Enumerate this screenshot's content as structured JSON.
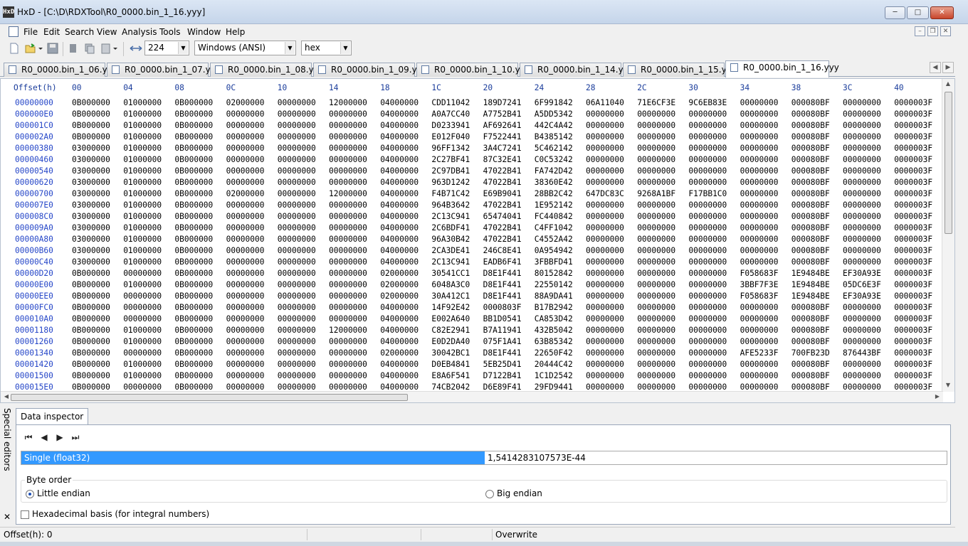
{
  "window": {
    "app_icon": "HxD",
    "title": "HxD - [C:\\D\\RDXTool\\R0_0000.bin_1_16.yyy]",
    "min_icon": "─",
    "max_icon": "□",
    "close_icon": "✕"
  },
  "menu": {
    "items": [
      "File",
      "Edit",
      "Search",
      "View",
      "Analysis",
      "Tools",
      "Window",
      "Help"
    ],
    "mdi_min": "–",
    "mdi_restore": "❐",
    "mdi_close": "✕"
  },
  "toolbar": {
    "bytes_per_row": "224",
    "charset": "Windows (ANSI)",
    "offset_base": "hex"
  },
  "tabs": [
    {
      "label": "R0_0000.bin_1_06.yyy"
    },
    {
      "label": "R0_0000.bin_1_07.yyy"
    },
    {
      "label": "R0_0000.bin_1_08.yyy"
    },
    {
      "label": "R0_0000.bin_1_09.yyy"
    },
    {
      "label": "R0_0000.bin_1_10.yyy"
    },
    {
      "label": "R0_0000.bin_1_14.yyy"
    },
    {
      "label": "R0_0000.bin_1_15.yyy"
    },
    {
      "label": "R0_0000.bin_1_16.yyy",
      "active": true
    }
  ],
  "hex": {
    "offset_header": "Offset(h)",
    "columns": [
      "00",
      "04",
      "08",
      "0C",
      "10",
      "14",
      "18",
      "1C",
      "20",
      "24",
      "28",
      "2C",
      "30",
      "34",
      "38",
      "3C",
      "40"
    ],
    "rows": [
      {
        "offset": "00000000",
        "cells": [
          "0B000000",
          "01000000",
          "0B000000",
          "02000000",
          "00000000",
          "12000000",
          "04000000",
          "CDD11042",
          "189D7241",
          "6F991842",
          "06A11040",
          "71E6CF3E",
          "9C6EB83E",
          "00000000",
          "000080BF",
          "00000000",
          "0000003F"
        ]
      },
      {
        "offset": "000000E0",
        "cells": [
          "0B000000",
          "01000000",
          "0B000000",
          "00000000",
          "00000000",
          "00000000",
          "04000000",
          "A0A7CC40",
          "A7752B41",
          "A5DD5342",
          "00000000",
          "00000000",
          "00000000",
          "00000000",
          "000080BF",
          "00000000",
          "0000003F"
        ]
      },
      {
        "offset": "000001C0",
        "cells": [
          "0B000000",
          "01000000",
          "0B000000",
          "00000000",
          "00000000",
          "00000000",
          "04000000",
          "D0233941",
          "AF692641",
          "442C4A42",
          "00000000",
          "00000000",
          "00000000",
          "00000000",
          "000080BF",
          "00000000",
          "0000003F"
        ]
      },
      {
        "offset": "000002A0",
        "cells": [
          "0B000000",
          "01000000",
          "0B000000",
          "00000000",
          "00000000",
          "00000000",
          "04000000",
          "E012F040",
          "F7522441",
          "B4385142",
          "00000000",
          "00000000",
          "00000000",
          "00000000",
          "000080BF",
          "00000000",
          "0000003F"
        ]
      },
      {
        "offset": "00000380",
        "cells": [
          "03000000",
          "01000000",
          "0B000000",
          "00000000",
          "00000000",
          "00000000",
          "04000000",
          "96FF1342",
          "3A4C7241",
          "5C462142",
          "00000000",
          "00000000",
          "00000000",
          "00000000",
          "000080BF",
          "00000000",
          "0000003F"
        ]
      },
      {
        "offset": "00000460",
        "cells": [
          "03000000",
          "01000000",
          "0B000000",
          "00000000",
          "00000000",
          "00000000",
          "04000000",
          "2C27BF41",
          "87C32E41",
          "C0C53242",
          "00000000",
          "00000000",
          "00000000",
          "00000000",
          "000080BF",
          "00000000",
          "0000003F"
        ]
      },
      {
        "offset": "00000540",
        "cells": [
          "03000000",
          "01000000",
          "0B000000",
          "00000000",
          "00000000",
          "00000000",
          "04000000",
          "2C97DB41",
          "47022B41",
          "FA742D42",
          "00000000",
          "00000000",
          "00000000",
          "00000000",
          "000080BF",
          "00000000",
          "0000003F"
        ]
      },
      {
        "offset": "00000620",
        "cells": [
          "03000000",
          "01000000",
          "0B000000",
          "00000000",
          "00000000",
          "00000000",
          "04000000",
          "963D1242",
          "47022B41",
          "38360E42",
          "00000000",
          "00000000",
          "00000000",
          "00000000",
          "000080BF",
          "00000000",
          "0000003F"
        ]
      },
      {
        "offset": "00000700",
        "cells": [
          "03000000",
          "01000000",
          "0B000000",
          "02000000",
          "00000000",
          "12000000",
          "04000000",
          "F4B71C42",
          "E69B9041",
          "28BB2C42",
          "647DC83C",
          "9268A1BF",
          "F17BB1C0",
          "00000000",
          "000080BF",
          "00000000",
          "0000003F"
        ]
      },
      {
        "offset": "000007E0",
        "cells": [
          "03000000",
          "01000000",
          "0B000000",
          "00000000",
          "00000000",
          "00000000",
          "04000000",
          "964B3642",
          "47022B41",
          "1E952142",
          "00000000",
          "00000000",
          "00000000",
          "00000000",
          "000080BF",
          "00000000",
          "0000003F"
        ]
      },
      {
        "offset": "000008C0",
        "cells": [
          "03000000",
          "01000000",
          "0B000000",
          "00000000",
          "00000000",
          "00000000",
          "04000000",
          "2C13C941",
          "65474041",
          "FC440842",
          "00000000",
          "00000000",
          "00000000",
          "00000000",
          "000080BF",
          "00000000",
          "0000003F"
        ]
      },
      {
        "offset": "000009A0",
        "cells": [
          "03000000",
          "01000000",
          "0B000000",
          "00000000",
          "00000000",
          "00000000",
          "04000000",
          "2C6BDF41",
          "47022B41",
          "C4FF1042",
          "00000000",
          "00000000",
          "00000000",
          "00000000",
          "000080BF",
          "00000000",
          "0000003F"
        ]
      },
      {
        "offset": "00000A80",
        "cells": [
          "03000000",
          "01000000",
          "0B000000",
          "00000000",
          "00000000",
          "00000000",
          "04000000",
          "96A30B42",
          "47022B41",
          "C4552A42",
          "00000000",
          "00000000",
          "00000000",
          "00000000",
          "000080BF",
          "00000000",
          "0000003F"
        ]
      },
      {
        "offset": "00000B60",
        "cells": [
          "03000000",
          "01000000",
          "0B000000",
          "00000000",
          "00000000",
          "00000000",
          "04000000",
          "2CA3DE41",
          "246C8E41",
          "0A954942",
          "00000000",
          "00000000",
          "00000000",
          "00000000",
          "000080BF",
          "00000000",
          "0000003F"
        ]
      },
      {
        "offset": "00000C40",
        "cells": [
          "03000000",
          "01000000",
          "0B000000",
          "00000000",
          "00000000",
          "00000000",
          "04000000",
          "2C13C941",
          "EADB6F41",
          "3FBBFD41",
          "00000000",
          "00000000",
          "00000000",
          "00000000",
          "000080BF",
          "00000000",
          "0000003F"
        ]
      },
      {
        "offset": "00000D20",
        "cells": [
          "0B000000",
          "00000000",
          "0B000000",
          "00000000",
          "00000000",
          "00000000",
          "02000000",
          "30541CC1",
          "D8E1F441",
          "80152842",
          "00000000",
          "00000000",
          "00000000",
          "F058683F",
          "1E9484BE",
          "EF30A93E",
          "0000003F"
        ]
      },
      {
        "offset": "00000E00",
        "cells": [
          "0B000000",
          "01000000",
          "0B000000",
          "00000000",
          "00000000",
          "00000000",
          "02000000",
          "6048A3C0",
          "D8E1F441",
          "22550142",
          "00000000",
          "00000000",
          "00000000",
          "3BBF7F3E",
          "1E9484BE",
          "05DC6E3F",
          "0000003F"
        ]
      },
      {
        "offset": "00000EE0",
        "cells": [
          "0B000000",
          "00000000",
          "0B000000",
          "00000000",
          "00000000",
          "00000000",
          "02000000",
          "30A412C1",
          "D8E1F441",
          "88A9DA41",
          "00000000",
          "00000000",
          "00000000",
          "F058683F",
          "1E9484BE",
          "EF30A93E",
          "0000003F"
        ]
      },
      {
        "offset": "00000FC0",
        "cells": [
          "0B000000",
          "00000000",
          "0B000000",
          "00000000",
          "00000000",
          "00000000",
          "04000000",
          "14F92E42",
          "0000803F",
          "B17B2942",
          "00000000",
          "00000000",
          "00000000",
          "00000000",
          "000080BF",
          "00000000",
          "0000003F"
        ]
      },
      {
        "offset": "000010A0",
        "cells": [
          "0B000000",
          "00000000",
          "0B000000",
          "00000000",
          "00000000",
          "00000000",
          "04000000",
          "E002A640",
          "BB1D0541",
          "CA853D42",
          "00000000",
          "00000000",
          "00000000",
          "00000000",
          "000080BF",
          "00000000",
          "0000003F"
        ]
      },
      {
        "offset": "00001180",
        "cells": [
          "0B000000",
          "01000000",
          "0B000000",
          "00000000",
          "00000000",
          "12000000",
          "04000000",
          "C82E2941",
          "B7A11941",
          "432B5042",
          "00000000",
          "00000000",
          "00000000",
          "00000000",
          "000080BF",
          "00000000",
          "0000003F"
        ]
      },
      {
        "offset": "00001260",
        "cells": [
          "0B000000",
          "01000000",
          "0B000000",
          "00000000",
          "00000000",
          "00000000",
          "04000000",
          "E0D2DA40",
          "075F1A41",
          "63B85342",
          "00000000",
          "00000000",
          "00000000",
          "00000000",
          "000080BF",
          "00000000",
          "0000003F"
        ]
      },
      {
        "offset": "00001340",
        "cells": [
          "0B000000",
          "00000000",
          "0B000000",
          "00000000",
          "00000000",
          "00000000",
          "02000000",
          "30042BC1",
          "D8E1F441",
          "22650F42",
          "00000000",
          "00000000",
          "00000000",
          "AFE5233F",
          "700FB23D",
          "876443BF",
          "0000003F"
        ]
      },
      {
        "offset": "00001420",
        "cells": [
          "0B000000",
          "01000000",
          "0B000000",
          "00000000",
          "00000000",
          "00000000",
          "04000000",
          "D0EB4841",
          "5EB25D41",
          "20444C42",
          "00000000",
          "00000000",
          "00000000",
          "00000000",
          "000080BF",
          "00000000",
          "0000003F"
        ]
      },
      {
        "offset": "00001500",
        "cells": [
          "0B000000",
          "01000000",
          "0B000000",
          "00000000",
          "00000000",
          "00000000",
          "04000000",
          "E8A6F541",
          "D7122B41",
          "1C1D2542",
          "00000000",
          "00000000",
          "00000000",
          "00000000",
          "000080BF",
          "00000000",
          "0000003F"
        ]
      },
      {
        "offset": "000015E0",
        "cells": [
          "0B000000",
          "00000000",
          "0B000000",
          "00000000",
          "00000000",
          "00000000",
          "04000000",
          "74CB2042",
          "D6E89F41",
          "29FD9441",
          "00000000",
          "00000000",
          "00000000",
          "00000000",
          "000080BF",
          "00000000",
          "0000003F"
        ]
      }
    ]
  },
  "side_panel": {
    "label": "Special editors",
    "close": "✕"
  },
  "inspector": {
    "tab_label": "Data inspector",
    "nav": [
      "⏮",
      "◀",
      "▶",
      "⏭"
    ],
    "field_name": "Single (float32)",
    "field_value": "1,5414283107573E-44",
    "byte_order_label": "Byte order",
    "little_endian": "Little endian",
    "big_endian": "Big endian",
    "little_selected": true,
    "hex_basis_label": "Hexadecimal basis (for integral numbers)"
  },
  "status": {
    "offset": "Offset(h): 0",
    "mode": "Overwrite"
  }
}
